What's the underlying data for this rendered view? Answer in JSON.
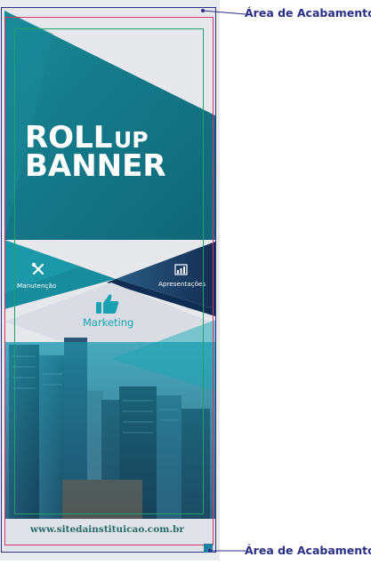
{
  "annotations": {
    "top_label": "Área de Acabamento",
    "bottom_label": "Área de Acabamento"
  },
  "banner": {
    "title_word1": "ROLL",
    "title_word2": "UP",
    "title_word3": "BANNER",
    "features": [
      {
        "label": "Manutenção",
        "icon": "tools-icon"
      },
      {
        "label": "Apresentações",
        "icon": "chart-icon"
      },
      {
        "label": "Marketing",
        "icon": "thumbs-up-icon"
      }
    ],
    "website": "www.sitedainstituicao.com.br"
  },
  "colors": {
    "teal": "#157b8a",
    "dark_teal": "#0f5e72",
    "navy": "#1c3a66",
    "light_gray": "#e4e6ea",
    "guide_blue": "#2a2f86",
    "guide_pink": "#d6356a",
    "guide_green": "#22a06b"
  }
}
